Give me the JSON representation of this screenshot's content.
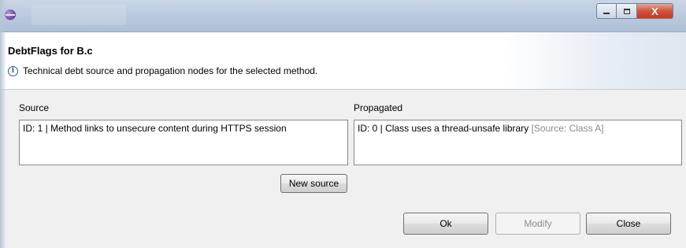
{
  "dialog": {
    "title": "DebtFlags for B.c",
    "info": "Technical debt source and propagation nodes for the selected method."
  },
  "window_controls": {
    "close_glyph": "X",
    "minimize_icon": "minimize-icon",
    "maximize_icon": "maximize-icon"
  },
  "source": {
    "label": "Source",
    "items": [
      "ID: 1 | Method links to unsecure content during HTTPS session"
    ]
  },
  "propagated": {
    "label": "Propagated",
    "items": [
      {
        "text": "ID: 0 | Class uses a thread-unsafe library",
        "source_note": "[Source: Class A]"
      }
    ]
  },
  "buttons": {
    "new_source": "New source",
    "ok": "Ok",
    "modify": "Modify",
    "close": "Close"
  },
  "colors": {
    "title_bar": "#b9c9dd",
    "close_button": "#c23b22",
    "info_icon": "#2b5aa0",
    "muted_text": "#8a8a8a"
  }
}
